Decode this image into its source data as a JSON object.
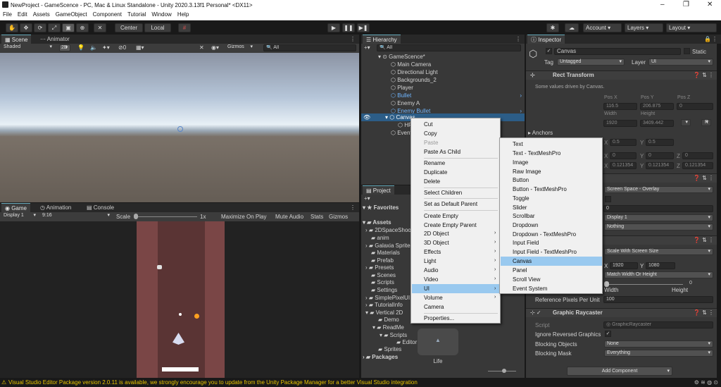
{
  "window": {
    "title": "NewProject - GameScence - PC, Mac & Linux Standalone - Unity 2020.3.13f1 Personal* <DX11>"
  },
  "menu": [
    "File",
    "Edit",
    "Assets",
    "GameObject",
    "Component",
    "Tutorial",
    "Window",
    "Help"
  ],
  "toolbar": {
    "center": "Center",
    "local": "Local",
    "account": "Account",
    "layers": "Layers",
    "layout": "Layout"
  },
  "scene": {
    "tab_scene": "Scene",
    "tab_animator": "Animator",
    "shading": "Shaded",
    "mode2d": "2D",
    "gizmos": "Gizmos",
    "search_placeholder": "All",
    "fx_count": "0"
  },
  "game": {
    "tab_game": "Game",
    "tab_animation": "Animation",
    "tab_console": "Console",
    "display": "Display 1",
    "aspect": "9:16",
    "scale_label": "Scale",
    "scale_value": "1x",
    "maximize": "Maximize On Play",
    "mute": "Mute Audio",
    "stats": "Stats",
    "gizmos": "Gizmos"
  },
  "hierarchy": {
    "tab": "Hierarchy",
    "search_placeholder": "All",
    "items": [
      {
        "label": "GameScence*",
        "indent": 0
      },
      {
        "label": "Main Camera",
        "indent": 1
      },
      {
        "label": "Directional Light",
        "indent": 1
      },
      {
        "label": "Backgrounds_2",
        "indent": 1
      },
      {
        "label": "Player",
        "indent": 1
      },
      {
        "label": "Bullet",
        "indent": 1
      },
      {
        "label": "Enemy A",
        "indent": 1
      },
      {
        "label": "Enemy Bullet",
        "indent": 1
      },
      {
        "label": "Canvas",
        "indent": 1
      },
      {
        "label": "HP",
        "indent": 2
      },
      {
        "label": "EventSystem",
        "indent": 1
      }
    ]
  },
  "project": {
    "tab": "Project",
    "favorites": "Favorites",
    "assets": "Assets",
    "packages": "Packages",
    "tree": [
      "2DSpaceShooter",
      "anim",
      "Galaxia Sprites",
      "Materials",
      "Prefab",
      "Presets",
      "Scenes",
      "Scripts",
      "Settings",
      "SimplePixelUI",
      "TutorialInfo",
      "Vertical 2D",
      "Demo",
      "ReadMe",
      "Scripts",
      "Editor",
      "Sprites"
    ],
    "asset_label": "Life"
  },
  "context_menu": {
    "items": [
      "Cut",
      "Copy",
      "Paste",
      "Paste As Child",
      "Rename",
      "Duplicate",
      "Delete",
      "Select Children",
      "Set as Default Parent",
      "Create Empty",
      "Create Empty Parent",
      "2D Object",
      "3D Object",
      "Effects",
      "Light",
      "Audio",
      "Video",
      "UI",
      "Volume",
      "Camera",
      "Properties..."
    ]
  },
  "ui_submenu": {
    "items": [
      "Text",
      "Text - TextMeshPro",
      "Image",
      "Raw Image",
      "Button",
      "Button - TextMeshPro",
      "Toggle",
      "Slider",
      "Scrollbar",
      "Dropdown",
      "Dropdown - TextMeshPro",
      "Input Field",
      "Input Field - TextMeshPro",
      "Canvas",
      "Panel",
      "Scroll View",
      "Event System"
    ]
  },
  "inspector": {
    "tab": "Inspector",
    "name": "Canvas",
    "static": "Static",
    "tag_label": "Tag",
    "tag": "Untagged",
    "layer_label": "Layer",
    "layer": "UI",
    "rect_transform": "Rect Transform",
    "driven_note": "Some values driven by Canvas.",
    "posx_l": "Pos X",
    "posy_l": "Pos Y",
    "posz_l": "Pos Z",
    "posx": "116.5",
    "posy": "206.875",
    "posz": "0",
    "width_l": "Width",
    "height_l": "Height",
    "width": "1920",
    "height": "3409.442",
    "r_btn": "R",
    "anchors": "Anchors",
    "pivot_x": "0.5",
    "pivot_y": "0.5",
    "rot_x": "0",
    "rot_y": "0",
    "rot_z": "0",
    "scale_x": "0.121354",
    "scale_y": "0.121354",
    "scale_z": "0.121354",
    "render_mode": "Screen Space - Overlay",
    "sort_order": "0",
    "target_display": "Display 1",
    "additional_channels": "Nothing",
    "ui_scale_mode": "Scale With Screen Size",
    "ref_x": "1920",
    "ref_y": "1080",
    "screen_match": "Match Width Or Height",
    "match_value": "0",
    "match_width": "Width",
    "match_height": "Height",
    "ref_ppu_label": "Reference Pixels Per Unit",
    "ref_ppu": "100",
    "graphic_raycaster": "Graphic Raycaster",
    "script_label": "Script",
    "script": "GraphicRaycaster",
    "ignore_reversed": "Ignore Reversed Graphics",
    "blocking_objects_label": "Blocking Objects",
    "blocking_objects": "None",
    "blocking_mask_label": "Blocking Mask",
    "blocking_mask": "Everything",
    "add_component": "Add Component",
    "x_l": "X",
    "y_l": "Y",
    "z_l": "Z"
  },
  "status": {
    "message": "Visual Studio Editor Package version 2.0.11 is available, we strongly encourage you to update from the Unity Package Manager for a better Visual Studio integration"
  },
  "colors": {
    "selection": "#2c5d87",
    "menu_highlight": "#99c9ef",
    "accent_blue": "#6fb6ff",
    "road": "#7a4646"
  }
}
